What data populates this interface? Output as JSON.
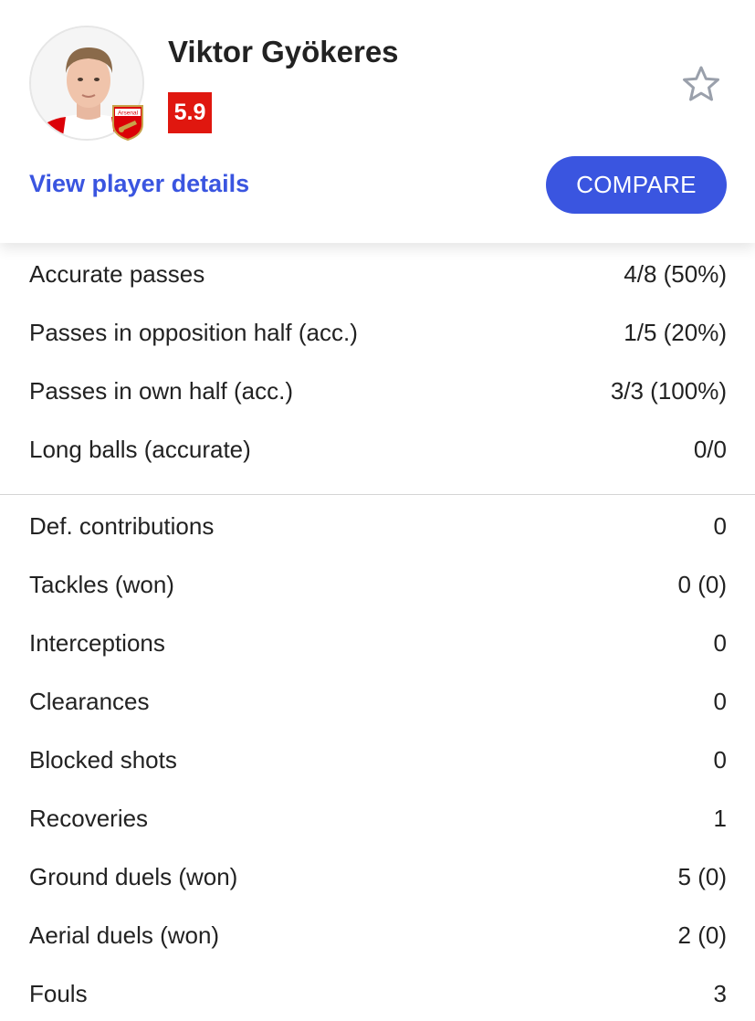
{
  "player": {
    "name": "Viktor Gyökeres",
    "rating": "5.9",
    "club_badge_text": "Arsenal"
  },
  "actions": {
    "details_link": "View player details",
    "compare_button": "COMPARE"
  },
  "icons": {
    "favorite": "star-outline-icon",
    "club": "arsenal-crest-icon"
  },
  "colors": {
    "accent": "#3a55e0",
    "rating_bg": "#e0170f",
    "club_red": "#db0007"
  },
  "passing_stats": [
    {
      "label": "Accurate passes",
      "value": "4/8 (50%)"
    },
    {
      "label": "Passes in opposition half (acc.)",
      "value": "1/5 (20%)"
    },
    {
      "label": "Passes in own half (acc.)",
      "value": "3/3 (100%)"
    },
    {
      "label": "Long balls (accurate)",
      "value": "0/0"
    }
  ],
  "defensive_stats": [
    {
      "label": "Def. contributions",
      "value": "0"
    },
    {
      "label": "Tackles (won)",
      "value": "0 (0)"
    },
    {
      "label": "Interceptions",
      "value": "0"
    },
    {
      "label": "Clearances",
      "value": "0"
    },
    {
      "label": "Blocked shots",
      "value": "0"
    },
    {
      "label": "Recoveries",
      "value": "1"
    },
    {
      "label": "Ground duels (won)",
      "value": "5 (0)"
    },
    {
      "label": "Aerial duels (won)",
      "value": "2 (0)"
    },
    {
      "label": "Fouls",
      "value": "3"
    }
  ]
}
